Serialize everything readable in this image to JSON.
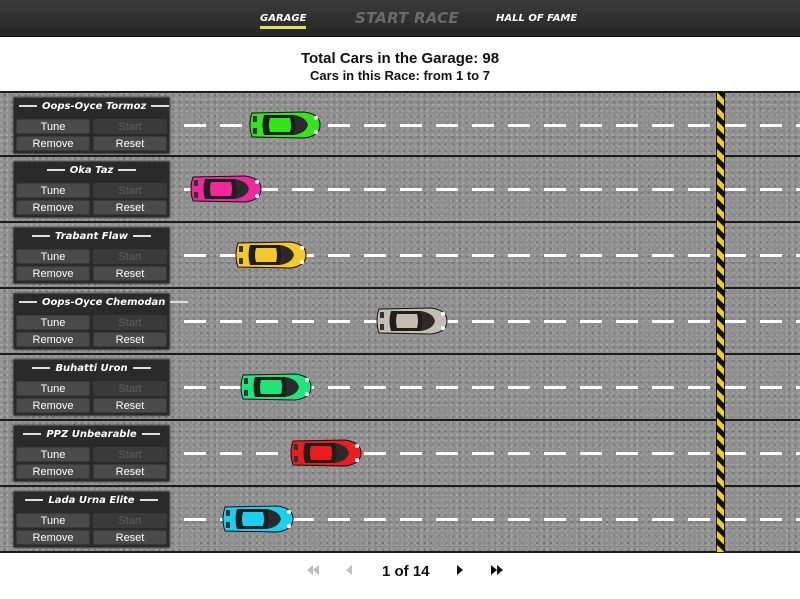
{
  "nav": {
    "garage": "GARAGE",
    "start_race": "START RACE",
    "hall_of_fame": "HALL OF FAME"
  },
  "header": {
    "title": "Total Cars in the Garage: 98",
    "subtitle": "Cars in this Race: from 1 to 7"
  },
  "buttons": {
    "tune": "Tune",
    "start": "Start",
    "remove": "Remove",
    "reset": "Reset"
  },
  "cars": [
    {
      "name": "Oops-Oyce Tormoz",
      "color": "#33e619",
      "progress": 0.13
    },
    {
      "name": "Oka Taz",
      "color": "#f0289c",
      "progress": 0.0
    },
    {
      "name": "Trabant Flaw",
      "color": "#f5c92b",
      "progress": 0.1
    },
    {
      "name": "Oops-Oyce Chemodan",
      "color": "#c4bdb0",
      "progress": 0.41
    },
    {
      "name": "Buhatti Uron",
      "color": "#1fe67a",
      "progress": 0.11
    },
    {
      "name": "PPZ Unbearable",
      "color": "#ee1c1c",
      "progress": 0.22
    },
    {
      "name": "Lada Urna Elite",
      "color": "#1ad0f0",
      "progress": 0.07
    }
  ],
  "pagination": {
    "first_icon": "first-page-icon",
    "prev_icon": "prev-page-icon",
    "label": "1 of 14",
    "next_icon": "next-page-icon",
    "last_icon": "last-page-icon"
  }
}
